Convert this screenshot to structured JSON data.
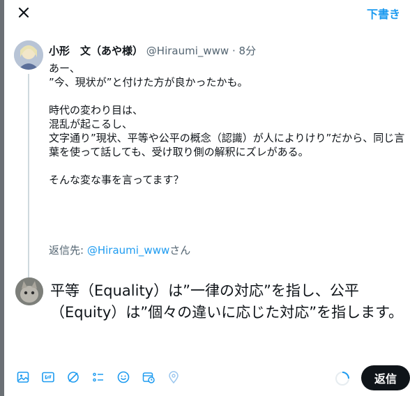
{
  "topbar": {
    "draft_label": "下書き"
  },
  "tweet": {
    "author_name": "小形　文（あや様）",
    "handle": "@Hiraumi_www",
    "separator": "·",
    "time": "8分",
    "lines": [
      "あー、",
      "”今、現状が”と付けた方が良かったかも。",
      "",
      "時代の変わり目は、",
      "混乱が起こるし、",
      "文字通り”現状、平等や公平の概念（認識）が人によりけり”だから、同じ言葉を使って話しても、受け取り側の解釈にズレがある。",
      "",
      "そんな変な事を言ってます？"
    ],
    "reply_prefix": "返信先: ",
    "reply_mention": "@Hiraumi_www",
    "reply_suffix": "さん"
  },
  "compose": {
    "text": "平等（Equality）は”一律の対応”を指し、公平（Equity）は”個々の違いに応じた対応”を指します。"
  },
  "toolbar": {
    "icons": [
      "image-icon",
      "gif-icon",
      "poll-icon",
      "list-icon",
      "emoji-icon",
      "schedule-icon",
      "location-icon"
    ],
    "reply_label": "返信"
  },
  "colors": {
    "accent": "#1d9bf0",
    "text": "#0f1419",
    "muted": "#536471",
    "button_bg": "#0f1419"
  }
}
